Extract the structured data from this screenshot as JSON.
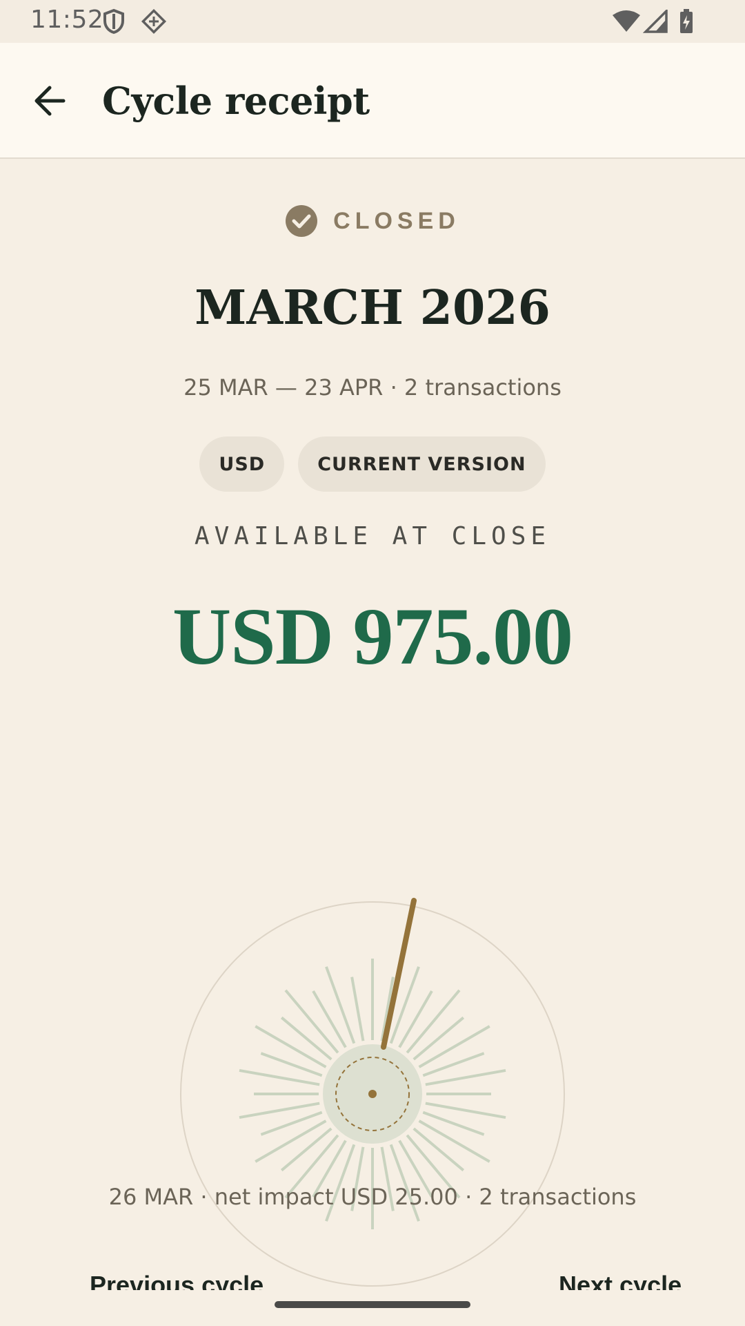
{
  "status_bar": {
    "time": "11:52",
    "icons": [
      "shield-icon",
      "vpn-diamond-icon",
      "wifi-icon",
      "signal-icon",
      "battery-charging-icon"
    ]
  },
  "app_bar": {
    "back_icon": "arrow-back-icon",
    "title": "Cycle receipt"
  },
  "receipt": {
    "status_icon": "check-circle-icon",
    "status": "CLOSED",
    "period": "MARCH 2026",
    "subline": "25 MAR — 23 APR · 2 transactions",
    "chips": [
      "USD",
      "CURRENT VERSION"
    ],
    "available_label": "AVAILABLE AT CLOSE",
    "amount": "USD 975.00",
    "dial_summary": "26 MAR · net impact USD 25.00 · 2 transactions",
    "prev_label": "Previous cycle",
    "next_label": "Next cycle"
  },
  "colors": {
    "background": "#f6efe4",
    "accent_green": "#1f6a4a",
    "needle": "#94733a",
    "rays": "#c9d3bf",
    "status": "#8a7b63"
  }
}
